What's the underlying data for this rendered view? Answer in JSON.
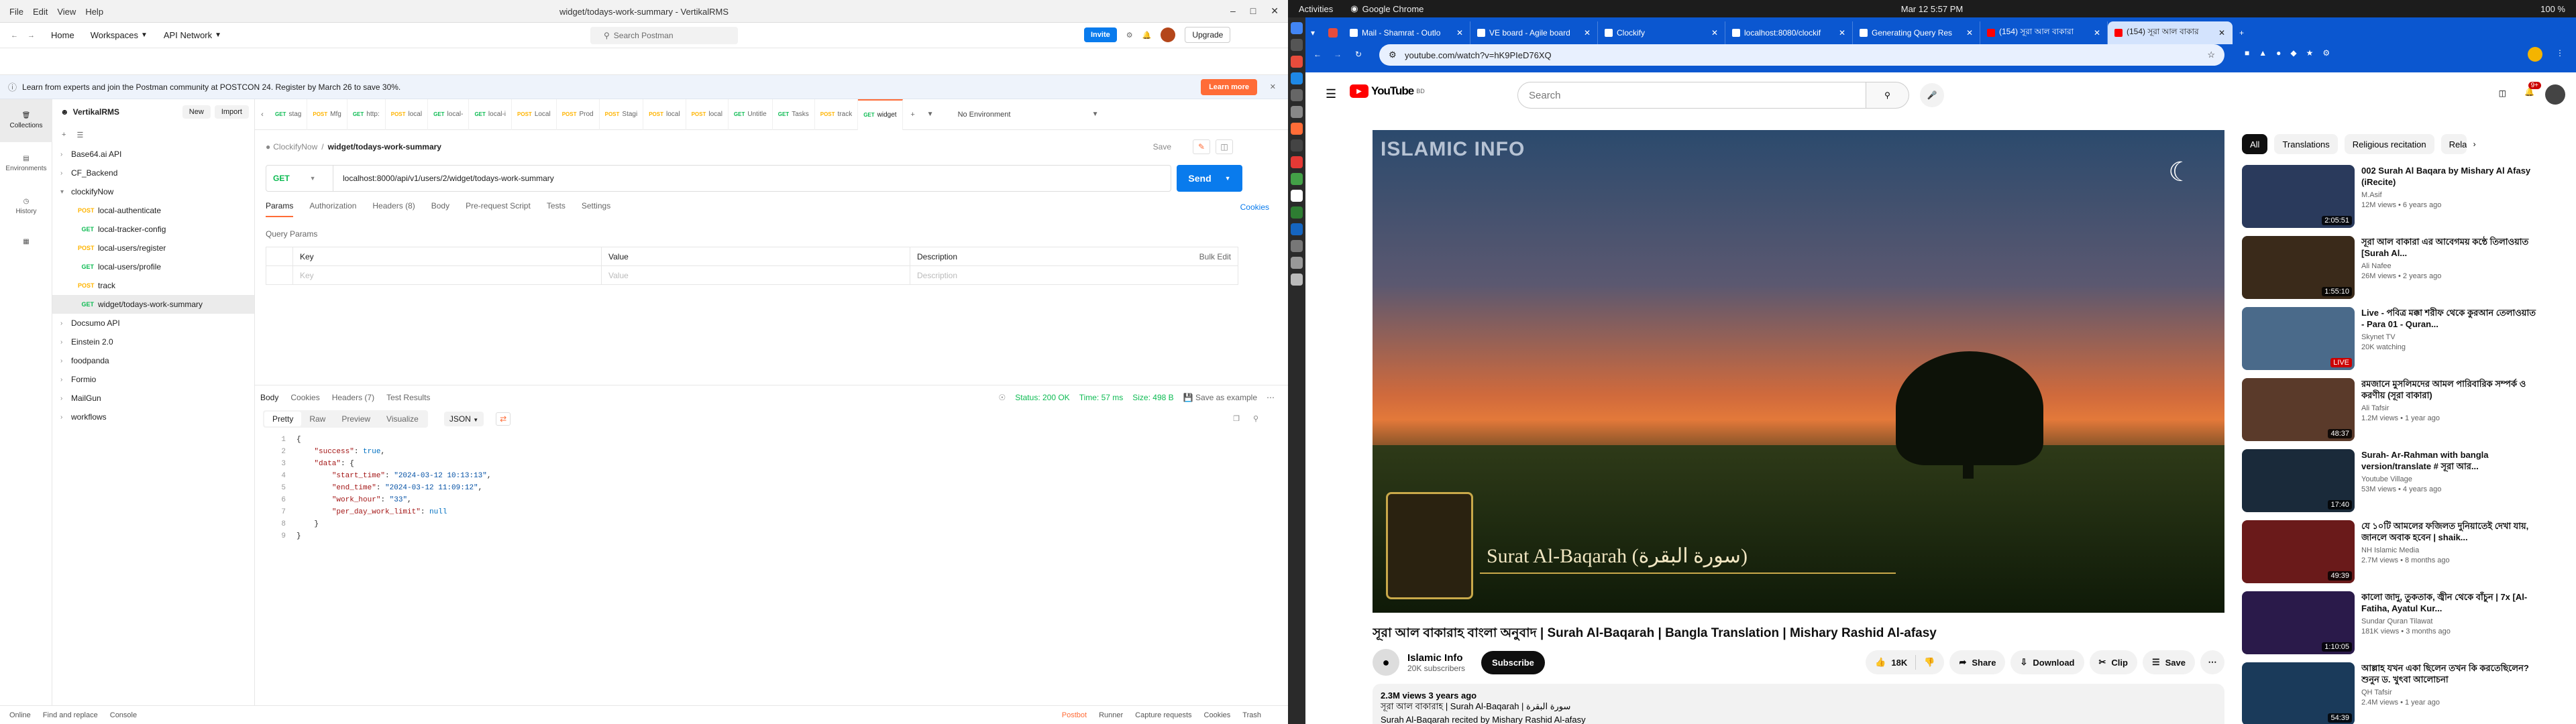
{
  "postman": {
    "window_title": "widget/todays-work-summary - VertikalRMS",
    "menu": [
      "File",
      "Edit",
      "View",
      "Help"
    ],
    "nav": {
      "home": "Home",
      "workspaces": "Workspaces",
      "api_network": "API Network",
      "search_placeholder": "Search Postman",
      "invite": "Invite",
      "upgrade": "Upgrade"
    },
    "banner": {
      "text": "Learn from experts and join the Postman community at POSTCON 24. Register by March 26 to save 30%.",
      "button": "Learn more"
    },
    "workspace": {
      "name": "VertikalRMS",
      "new": "New",
      "import": "Import"
    },
    "rail": [
      "Collections",
      "Environments",
      "History"
    ],
    "tree": [
      {
        "label": "Base64.ai API",
        "level": 0
      },
      {
        "label": "CF_Backend",
        "level": 0
      },
      {
        "label": "clockifyNow",
        "level": 0,
        "open": true
      },
      {
        "method": "POST",
        "label": "local-authenticate",
        "level": 1
      },
      {
        "method": "GET",
        "label": "local-tracker-config",
        "level": 1
      },
      {
        "method": "POST",
        "label": "local-users/register",
        "level": 1
      },
      {
        "method": "GET",
        "label": "local-users/profile",
        "level": 1
      },
      {
        "method": "POST",
        "label": "track",
        "level": 1
      },
      {
        "method": "GET",
        "label": "widget/todays-work-summary",
        "level": 1,
        "selected": true
      },
      {
        "label": "Docsumo API",
        "level": 0
      },
      {
        "label": "Einstein 2.0",
        "level": 0
      },
      {
        "label": "foodpanda",
        "level": 0
      },
      {
        "label": "Formio",
        "level": 0
      },
      {
        "label": "MailGun",
        "level": 0
      },
      {
        "label": "workflows",
        "level": 0
      }
    ],
    "tabs": [
      {
        "method": "GET",
        "label": "stag"
      },
      {
        "method": "POST",
        "label": "Mfg"
      },
      {
        "method": "GET",
        "label": "http:"
      },
      {
        "method": "POST",
        "label": "local"
      },
      {
        "method": "GET",
        "label": "local-"
      },
      {
        "method": "GET",
        "label": "local-i"
      },
      {
        "method": "POST",
        "label": "Local"
      },
      {
        "method": "POST",
        "label": "Prod"
      },
      {
        "method": "POST",
        "label": "Stagi"
      },
      {
        "method": "POST",
        "label": "local"
      },
      {
        "method": "POST",
        "label": "local"
      },
      {
        "method": "GET",
        "label": "Untitle"
      },
      {
        "method": "GET",
        "label": "Tasks"
      },
      {
        "method": "POST",
        "label": "track"
      },
      {
        "method": "GET",
        "label": "widget",
        "active": true
      }
    ],
    "no_environment": "No Environment",
    "breadcrumb": {
      "collection": "ClockifyNow",
      "request": "widget/todays-work-summary"
    },
    "save": "Save",
    "method": "GET",
    "url": "localhost:8000/api/v1/users/2/widget/todays-work-summary",
    "send": "Send",
    "req_tabs": [
      "Params",
      "Authorization",
      "Headers (8)",
      "Body",
      "Pre-request Script",
      "Tests",
      "Settings"
    ],
    "cookies": "Cookies",
    "query_params_label": "Query Params",
    "table": {
      "cols": [
        "Key",
        "Value",
        "Description"
      ],
      "bulk_edit": "Bulk Edit",
      "placeholder": [
        "Key",
        "Value",
        "Description"
      ]
    },
    "response": {
      "tabs": [
        "Body",
        "Cookies",
        "Headers (7)",
        "Test Results"
      ],
      "status": "Status: 200 OK",
      "time": "Time: 57 ms",
      "size": "Size: 498 B",
      "save_example": "Save as example",
      "views": [
        "Pretty",
        "Raw",
        "Preview",
        "Visualize"
      ],
      "format": "JSON",
      "lines": [
        [
          {
            "t": "{",
            "c": "p"
          }
        ],
        [
          {
            "t": "    ",
            "c": "p"
          },
          {
            "t": "\"success\"",
            "c": "k"
          },
          {
            "t": ": ",
            "c": "p"
          },
          {
            "t": "true",
            "c": "n"
          },
          {
            "t": ",",
            "c": "p"
          }
        ],
        [
          {
            "t": "    ",
            "c": "p"
          },
          {
            "t": "\"data\"",
            "c": "k"
          },
          {
            "t": ": {",
            "c": "p"
          }
        ],
        [
          {
            "t": "        ",
            "c": "p"
          },
          {
            "t": "\"start_time\"",
            "c": "k"
          },
          {
            "t": ": ",
            "c": "p"
          },
          {
            "t": "\"2024-03-12 10:13:13\"",
            "c": "s"
          },
          {
            "t": ",",
            "c": "p"
          }
        ],
        [
          {
            "t": "        ",
            "c": "p"
          },
          {
            "t": "\"end_time\"",
            "c": "k"
          },
          {
            "t": ": ",
            "c": "p"
          },
          {
            "t": "\"2024-03-12 11:09:12\"",
            "c": "s"
          },
          {
            "t": ",",
            "c": "p"
          }
        ],
        [
          {
            "t": "        ",
            "c": "p"
          },
          {
            "t": "\"work_hour\"",
            "c": "k"
          },
          {
            "t": ": ",
            "c": "p"
          },
          {
            "t": "\"33\"",
            "c": "s"
          },
          {
            "t": ",",
            "c": "p"
          }
        ],
        [
          {
            "t": "        ",
            "c": "p"
          },
          {
            "t": "\"per_day_work_limit\"",
            "c": "k"
          },
          {
            "t": ": ",
            "c": "p"
          },
          {
            "t": "null",
            "c": "n"
          }
        ],
        [
          {
            "t": "    }",
            "c": "p"
          }
        ],
        [
          {
            "t": "}",
            "c": "p"
          }
        ]
      ]
    },
    "footer": {
      "left": [
        "Online",
        "Find and replace",
        "Console"
      ],
      "right": [
        "Postbot",
        "Runner",
        "Capture requests",
        "Cookies",
        "Trash"
      ]
    }
  },
  "desktop": {
    "activities": "Activities",
    "app": "Google Chrome",
    "clock": "Mar 12  5:57 PM",
    "battery": "100 %"
  },
  "chrome": {
    "tabs": [
      {
        "label": "Mail - Shamrat - Outlo"
      },
      {
        "label": "VE board - Agile board"
      },
      {
        "label": "Clockify"
      },
      {
        "label": "localhost:8080/clockif"
      },
      {
        "label": "Generating Query Res"
      },
      {
        "label": "(154) সূরা আল বাকারা"
      },
      {
        "label": "(154) সূরা আল বাকার",
        "active": true
      }
    ],
    "url": "youtube.com/watch?v=hK9PIeD76XQ"
  },
  "youtube": {
    "logo": "YouTube",
    "region": "BD",
    "search_placeholder": "Search",
    "notif": "9+",
    "video": {
      "overlay_title": "ISLAMIC INFO",
      "surah_text": "Surat Al-Baqarah (سورة البقرة)"
    },
    "title": "সূরা আল বাকারাহ বাংলা অনুবাদ | Surah Al-Baqarah | Bangla Translation | Mishary Rashid Al-afasy",
    "channel": "Islamic Info",
    "subscribers": "20K subscribers",
    "subscribe": "Subscribe",
    "likes": "18K",
    "share": "Share",
    "download": "Download",
    "clip": "Clip",
    "save": "Save",
    "desc_stats": "2.3M views  3 years ago",
    "desc_line1": "সূরা আল বাকারাহ | Surah Al-Baqarah | سورة البقرة",
    "desc_line2": "Surah Al-Baqarah recited by Mishary Rashid Al-afasy",
    "chips": [
      "All",
      "Translations",
      "Religious recitation",
      "Rela"
    ],
    "recs": [
      {
        "title": "002 Surah Al Baqara by Mishary Al Afasy (iRecite)",
        "channel": "M.Asif",
        "meta": "12M views • 6 years ago",
        "duration": "2:05:51",
        "color": "#2a3a5c"
      },
      {
        "title": "সূরা আল বাকারা এর আবেগময় কন্ঠে তিলাওয়াত [Surah Al...",
        "channel": "Ali Nafee",
        "meta": "26M views • 2 years ago",
        "duration": "1:55:10",
        "color": "#3a2a1a"
      },
      {
        "title": "Live - পবিত্র মক্কা শরীফ থেকে কুরআন তেলাওয়াত - Para 01 - Quran...",
        "channel": "Skynet TV",
        "meta": "20K watching",
        "duration": "LIVE",
        "color": "#4a6a8a"
      },
      {
        "title": "রমজানে মুসলিমদের আমল পারিবারিক সম্পর্ক ও করণীয় (সূরা বাকারা)",
        "channel": "Ali Tafsir",
        "meta": "1.2M views • 1 year ago",
        "duration": "48:37",
        "color": "#5a3a2a"
      },
      {
        "title": "Surah- Ar-Rahman with bangla version/translate # সূরা আর...",
        "channel": "Youtube Village",
        "meta": "53M views • 4 years ago",
        "duration": "17:40",
        "color": "#1a2a3a"
      },
      {
        "title": "যে ১০টি আমলের ফজিলত দুনিয়াতেই দেখা যায়, জানলে অবাক হবেন | shaik...",
        "channel": "NH Islamic Media",
        "meta": "2.7M views • 8 months ago",
        "duration": "49:39",
        "color": "#6a1a1a"
      },
      {
        "title": "কালো জাদু, তুকতাক, জ্বীন থেকে বাঁচুন | 7x [Al-Fatiha, Ayatul Kur...",
        "channel": "Sundar Quran Tilawat",
        "meta": "181K views • 3 months ago",
        "duration": "1:10:05",
        "color": "#2a1a4a"
      },
      {
        "title": "আল্লাহ যখন একা ছিলেন তখন কি করতেছিলেন? শুনুন ড. খুৎবা আলোচনা",
        "channel": "QH Tafsir",
        "meta": "2.4M views • 1 year ago",
        "duration": "54:39",
        "color": "#1a3a5a"
      }
    ]
  }
}
